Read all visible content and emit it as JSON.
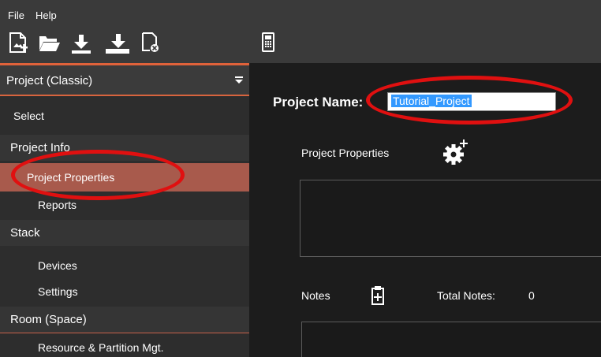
{
  "menu": {
    "file": "File",
    "help": "Help"
  },
  "toolbar": {
    "icons": [
      "new-project-icon",
      "open-folder-icon",
      "download-icon",
      "download-alt-icon",
      "close-document-icon",
      "device-panel-icon"
    ]
  },
  "sidebar": {
    "header": "Project (Classic)",
    "items": {
      "select": "Select",
      "project_info": "Project Info",
      "project_properties": "Project Properties",
      "reports": "Reports",
      "stack": "Stack",
      "devices": "Devices",
      "settings": "Settings",
      "room_space": "Room (Space)",
      "resource_partition": "Resource & Partition Mgt."
    }
  },
  "main": {
    "project_name_label": "Project Name:",
    "project_name_value": "Tutorial_Project",
    "project_properties_label": "Project Properties",
    "notes_label": "Notes",
    "total_notes_label": "Total Notes:",
    "total_notes_value": "0"
  },
  "colors": {
    "accent": "#e0623a",
    "selected": "#a85a4c",
    "highlight_ring": "#e01010",
    "selection": "#3399ff"
  }
}
